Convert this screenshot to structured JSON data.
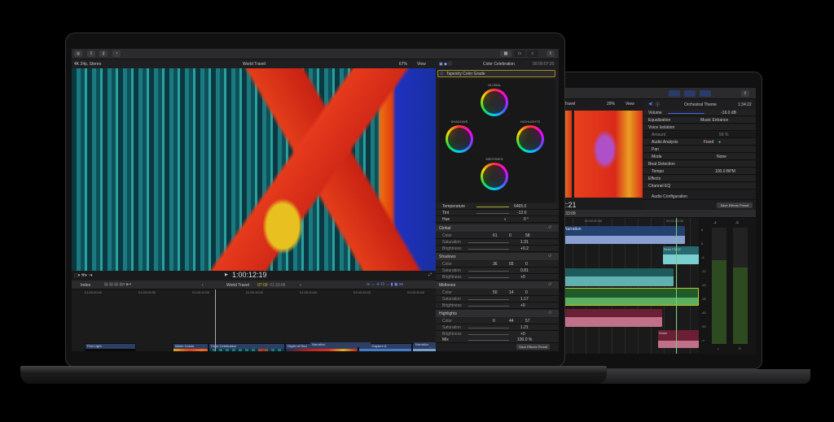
{
  "left": {
    "toolbar": {
      "icons": [
        "import-icon",
        "keyword-icon",
        "key-icon",
        "background-tasks-icon"
      ],
      "share": "share-icon"
    },
    "subheader": {
      "format": "4K 24p, Stereo",
      "project": "World Travel",
      "zoom": "67%",
      "view": "View",
      "inspector_title": "Color Celebration",
      "inspector_time": "00:00:07:20"
    },
    "viewer": {
      "timecode": "1:00:12:19"
    },
    "timeline": {
      "index": "Index",
      "project": "World Travel",
      "time": "07:09",
      "duration": "01:33:09",
      "ruler": [
        "01:00:00:00",
        "01:00:05:00",
        "01:00:10:00",
        "01:00:15:00",
        "01:00:20:00",
        "01:00:25:00",
        "01:00:30:00"
      ],
      "clips": [
        "First Light",
        "Warm Colors",
        "Color Celebration",
        "Depth of Red",
        "iPhone Capture A",
        "iPhone Capture A",
        "Day 16"
      ],
      "narration": [
        "Narration",
        "Narration"
      ]
    },
    "inspector": {
      "effect": "Tapestry Color Grade",
      "wheels": [
        "GLOBAL",
        "SHADOWS",
        "HIGHLIGHTS",
        "MIDTONES"
      ],
      "temperature": {
        "label": "Temperature",
        "value": "6465.0"
      },
      "tint": {
        "label": "Tint",
        "value": "-12.0"
      },
      "hue": {
        "label": "Hue",
        "value": "0 °"
      },
      "sections": [
        {
          "name": "Global",
          "color": [
            "61",
            "0",
            "58"
          ],
          "saturation": "1.31",
          "brightness": "+0.2"
        },
        {
          "name": "Shadows",
          "color": [
            "36",
            "55",
            "0"
          ],
          "saturation": "0.81",
          "brightness": "+0"
        },
        {
          "name": "Midtones",
          "color": [
            "50",
            "14",
            "0"
          ],
          "saturation": "1.17",
          "brightness": "+0"
        },
        {
          "name": "Highlights",
          "color": [
            "0",
            "44",
            "57"
          ],
          "saturation": "1.21",
          "brightness": "+0"
        }
      ],
      "labels": {
        "color": "Color",
        "saturation": "Saturation",
        "brightness": "Brightness"
      },
      "mix": {
        "label": "Mix",
        "value": "100.0 %"
      },
      "save": "Save Effects Preset"
    }
  },
  "right": {
    "viewer": {
      "project": "t Travel",
      "zoom": "29%",
      "view": "View",
      "timecode": "2:21"
    },
    "inspector": {
      "title": "Orchestral Theme",
      "time": "1:34:22",
      "volume": {
        "label": "Volume",
        "value": "-16.0 dB"
      },
      "equalization": {
        "label": "Equalization",
        "value": "Music Enhance"
      },
      "voice_isolation": "Voice Isolation",
      "amount": {
        "label": "Amount",
        "value": "50 %"
      },
      "audio_analysis": {
        "label": "Audio Analysis",
        "value": "Fixed"
      },
      "pan": "Pan",
      "mode": {
        "label": "Mode",
        "value": "None"
      },
      "beat_detection": "Beat Detection",
      "tempo": {
        "label": "Tempo",
        "value": "100.0 BPM"
      },
      "effects": "Effects",
      "channel_eq": "Channel EQ",
      "audio_config": "Audio Configuration",
      "save": "Save Effects Preset"
    },
    "timeline": {
      "time": "1:33:09",
      "ruler": [
        "00:00:50:00",
        "00:01:00:00"
      ],
      "clips": [
        "Narration",
        "Birds FX 02",
        "Water"
      ]
    },
    "meters": {
      "scale": [
        "6",
        "0",
        "-6",
        "-12",
        "-20",
        "-30",
        "-40",
        "-50",
        "-∞"
      ],
      "peaks": [
        "-4",
        "-5"
      ],
      "channels": [
        "L",
        "R"
      ],
      "levels": [
        0.72,
        0.66
      ]
    }
  }
}
